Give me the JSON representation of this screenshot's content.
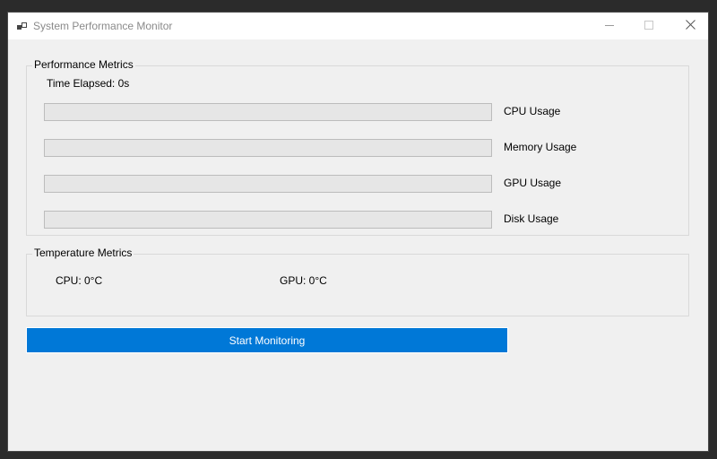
{
  "window": {
    "title": "System Performance Monitor"
  },
  "performance": {
    "legend": "Performance Metrics",
    "time_elapsed": "Time Elapsed: 0s",
    "metrics": [
      {
        "label": "CPU Usage",
        "value": 0
      },
      {
        "label": "Memory Usage",
        "value": 0
      },
      {
        "label": "GPU Usage",
        "value": 0
      },
      {
        "label": "Disk Usage",
        "value": 0
      }
    ]
  },
  "temperature": {
    "legend": "Temperature Metrics",
    "cpu": "CPU: 0°C",
    "gpu": "GPU: 0°C"
  },
  "actions": {
    "start_label": "Start Monitoring"
  },
  "colors": {
    "accent": "#0078d7",
    "progress_fill": "#06b025",
    "background": "#f0f0f0"
  },
  "icons": {
    "app": "windows-app-icon",
    "minimize": "minimize-icon",
    "maximize": "maximize-icon",
    "close": "close-icon"
  }
}
